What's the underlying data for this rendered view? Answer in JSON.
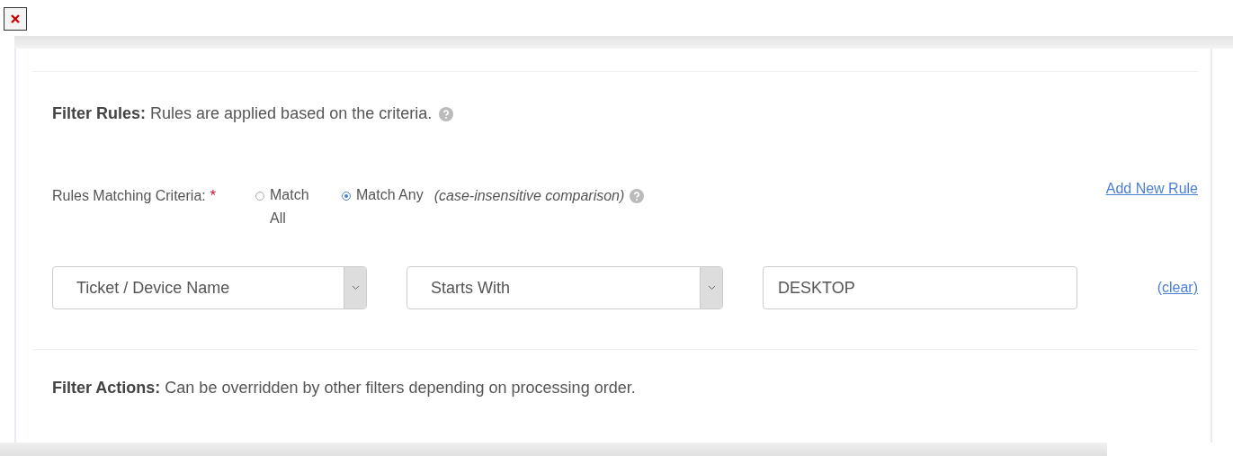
{
  "filter_rules": {
    "heading": "**Filter Rules:** Rules are applied based on the criteria."
  },
  "criteria": {
    "label": "Rules Matching Criteria:",
    "required_mark": "*",
    "options": [
      {
        "label": "Match All",
        "selected": false
      },
      {
        "label": "Match Any",
        "selected": true
      }
    ],
    "note": "(case-insensitive comparison)",
    "add_link": "Add New Rule"
  },
  "rule": {
    "field": "Ticket / Device Name",
    "operator": "Starts With",
    "value": "DESKTOP",
    "clear_link": "(clear)"
  },
  "filter_actions": {
    "heading": "**Filter Actions:** Can be overridden by other filters depending on processing order."
  }
}
